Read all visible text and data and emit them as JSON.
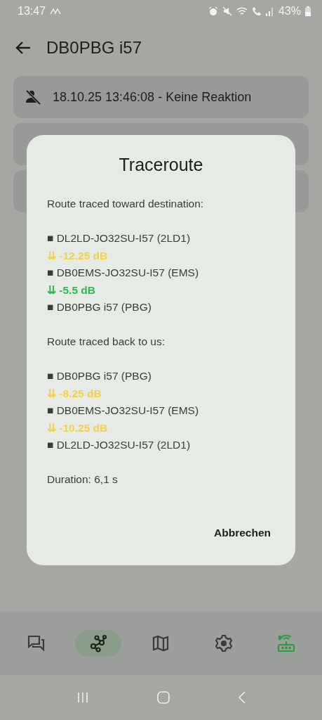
{
  "status_bar": {
    "time": "13:47",
    "battery": "43%"
  },
  "app_bar": {
    "title": "DB0PBG i57"
  },
  "cards": [
    {
      "covered": false,
      "text": "18.10.25 13:46:08 - Keine Reaktion"
    },
    {
      "covered": true
    },
    {
      "covered": true
    }
  ],
  "dialog": {
    "title": "Traceroute",
    "sections": [
      {
        "heading": "Route traced toward destination:",
        "hops": [
          {
            "kind": "node",
            "text": "■ DL2LD-JO32SU-I57 (2LD1)"
          },
          {
            "kind": "signal",
            "text": "⇊ -12.25 dB",
            "color": "#f6cf45"
          },
          {
            "kind": "node",
            "text": "■ DB0EMS-JO32SU-I57 (EMS)"
          },
          {
            "kind": "signal",
            "text": "⇊ -5.5 dB",
            "color": "#2fb94c"
          },
          {
            "kind": "node",
            "text": "■ DB0PBG i57 (PBG)"
          }
        ]
      },
      {
        "heading": "Route traced back to us:",
        "hops": [
          {
            "kind": "node",
            "text": "■ DB0PBG i57 (PBG)"
          },
          {
            "kind": "signal",
            "text": "⇊ -8.25 dB",
            "color": "#f6cf45"
          },
          {
            "kind": "node",
            "text": "■ DB0EMS-JO32SU-I57 (EMS)"
          },
          {
            "kind": "signal",
            "text": "⇊ -10.25 dB",
            "color": "#f6cf45"
          },
          {
            "kind": "node",
            "text": "■ DL2LD-JO32SU-I57 (2LD1)"
          }
        ]
      }
    ],
    "duration": "Duration: 6,1 s",
    "button": "Abbrechen"
  },
  "nav": [
    {
      "kind": "chat",
      "selected": false,
      "color": "#3a3c39"
    },
    {
      "kind": "graph",
      "selected": true,
      "color": "#1f221f"
    },
    {
      "kind": "map",
      "selected": false,
      "color": "#3a3c39"
    },
    {
      "kind": "settings",
      "selected": false,
      "color": "#3a3c39"
    },
    {
      "kind": "router",
      "selected": false,
      "color": "#2f9a3e"
    }
  ]
}
